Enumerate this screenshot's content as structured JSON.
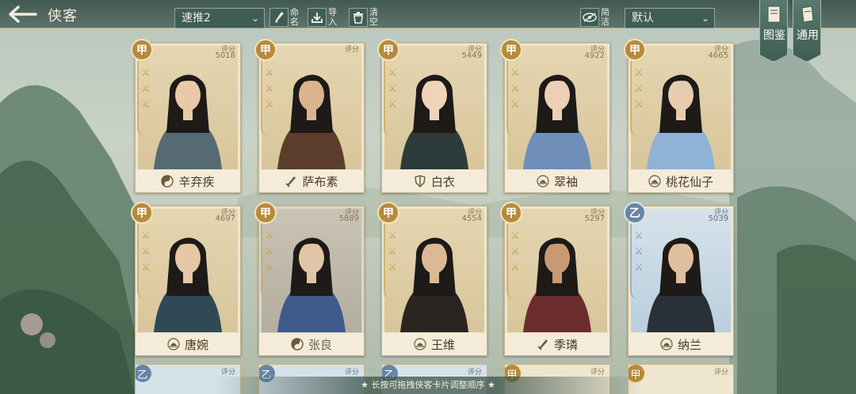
{
  "header": {
    "title": "侠客",
    "team_select": "速推2",
    "btn_name": "命名",
    "btn_import": "导入",
    "btn_clear": "清空",
    "btn_simple": "简洁",
    "sort_select": "默认",
    "tab_codex": "图鉴",
    "tab_general": "通用"
  },
  "score_label": "评分",
  "cards": [
    {
      "name": "辛弃疾",
      "grade": "甲",
      "score": "5018",
      "tier": "gold",
      "faction_icon": "taiji-icon"
    },
    {
      "name": "萨布素",
      "grade": "甲",
      "score": "",
      "tier": "gold",
      "faction_icon": "blade-icon"
    },
    {
      "name": "白衣",
      "grade": "甲",
      "score": "5449",
      "tier": "gold",
      "faction_icon": "shield-icon"
    },
    {
      "name": "翠袖",
      "grade": "甲",
      "score": "4922",
      "tier": "gold",
      "faction_icon": "lotus-icon"
    },
    {
      "name": "桃花仙子",
      "grade": "甲",
      "score": "4665",
      "tier": "gold",
      "faction_icon": "lotus-icon"
    },
    {
      "name": "唐婉",
      "grade": "甲",
      "score": "4697",
      "tier": "gold",
      "faction_icon": "lotus-icon"
    },
    {
      "name": "张良",
      "grade": "甲",
      "score": "5889",
      "tier": "grey",
      "faction_icon": "taiji-icon"
    },
    {
      "name": "王维",
      "grade": "甲",
      "score": "4554",
      "tier": "gold",
      "faction_icon": "lotus-icon"
    },
    {
      "name": "季璘",
      "grade": "甲",
      "score": "5297",
      "tier": "gold",
      "faction_icon": "blade-icon"
    },
    {
      "name": "纳兰",
      "grade": "乙",
      "score": "5039",
      "tier": "blue",
      "faction_icon": "lotus-icon"
    }
  ],
  "partial_cards": [
    {
      "grade": "乙",
      "tier": "blue"
    },
    {
      "grade": "乙",
      "tier": "blue"
    },
    {
      "grade": "乙",
      "tier": "blue"
    },
    {
      "grade": "甲",
      "tier": "gold"
    },
    {
      "grade": "甲",
      "tier": "gold"
    }
  ],
  "hint": "★ 长按可拖拽侠客卡片调整顺序 ★",
  "colors": {
    "accent_gold": "#b68a3e",
    "accent_blue": "#6686a6",
    "bar": "#3f5d55"
  }
}
